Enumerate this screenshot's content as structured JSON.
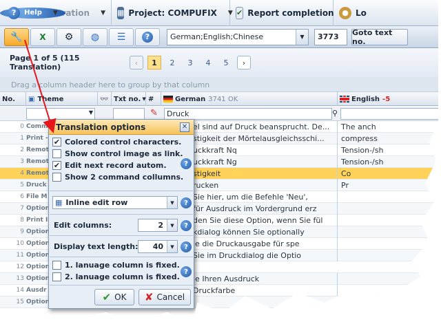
{
  "menu": {
    "administration": "Administration",
    "project": "Project: COMPUFIX",
    "report": "Report completion",
    "help": "Help",
    "login": "Lo"
  },
  "toolbar": {
    "languages": "German;English;Chinese",
    "record_number": "3773",
    "goto_label": "Goto text no."
  },
  "pager": {
    "info": "Page 1 of 5 (115 Translation)",
    "pages": [
      "1",
      "2",
      "3",
      "4",
      "5"
    ],
    "current_page": "1"
  },
  "group_hint": "Drag a column header here to group by that column",
  "grid": {
    "headers": {
      "no": "No.",
      "theme": "Theme",
      "txt_no": "Txt no.",
      "hash": "#",
      "german": "German",
      "german_count": "3741 OK",
      "english": "English",
      "english_count": "-5"
    },
    "filter_text": "Druck",
    "rows": [
      {
        "no": "0",
        "theme": "Comm",
        "de": "el sind auf Druck beansprucht. De...",
        "en": "The anch"
      },
      {
        "no": "1",
        "theme": "Print -",
        "de": "stigkeit der Mörtelausgleichsschi...",
        "en": "compress"
      },
      {
        "no": "2",
        "theme": "Remot",
        "de": "uckkraft Nq",
        "en": "Tension-/sh"
      },
      {
        "no": "3",
        "theme": "Remot",
        "de": "uckkraft Ng",
        "en": "Tension-/sh"
      },
      {
        "no": "4",
        "theme": "Remot",
        "de": "stigkeit",
        "en": "Co"
      },
      {
        "no": "5",
        "theme": "Druck",
        "de": "rucken",
        "en": "Pr"
      },
      {
        "no": "6",
        "theme": "File M",
        "de": "Sie hier, um die Befehle 'Neu',",
        "en": ""
      },
      {
        "no": "7",
        "theme": "Option",
        "de": "für Ausdruck im Vordergrund erz",
        "en": ""
      },
      {
        "no": "8",
        "theme": "Print I",
        "de": "den Sie diese Option, wenn Sie fül",
        "en": ""
      },
      {
        "no": "9",
        "theme": "Option",
        "de": "kdialog können Sie optionally",
        "en": ""
      },
      {
        "no": "10",
        "theme": "Option",
        "de": "ie die Druckausgabe für spe",
        "en": ""
      },
      {
        "no": "11",
        "theme": "Option",
        "de": "Sie im Druckdialog die Optio",
        "en": ""
      },
      {
        "no": "12",
        "theme": "Option",
        "de": "",
        "en": ""
      },
      {
        "no": "13",
        "theme": "Option",
        "de": "ie Ihren Ausdruck",
        "en": ""
      },
      {
        "no": "14",
        "theme": "Ausdr",
        "de": "Druckfarbe",
        "en": ""
      },
      {
        "no": "15",
        "theme": "Option",
        "de": "",
        "en": ""
      }
    ]
  },
  "dialog": {
    "title": "Translation options",
    "options": [
      {
        "label": "Colored control characters.",
        "checked": true
      },
      {
        "label": "Show control image as link.",
        "checked": false
      },
      {
        "label": "Edit next record autom.",
        "checked": true
      },
      {
        "label": "Show 2 command collumns.",
        "checked": false
      }
    ],
    "edit_mode": "Inline edit row",
    "edit_columns_label": "Edit columns:",
    "edit_columns_value": "2",
    "display_length_label": "Display text length:",
    "display_length_value": "40",
    "fixed_options": [
      {
        "label": "1. lanuage column is fixed.",
        "checked": false
      },
      {
        "label": "2. lanuage column is fixed.",
        "checked": false
      }
    ],
    "ok_label": "OK",
    "cancel_label": "Cancel"
  },
  "colors": {
    "accent_orange": "#f6a828",
    "selected_row": "#ffd35a",
    "error_red": "#d0262a",
    "arrow_red": "#e8151b"
  }
}
